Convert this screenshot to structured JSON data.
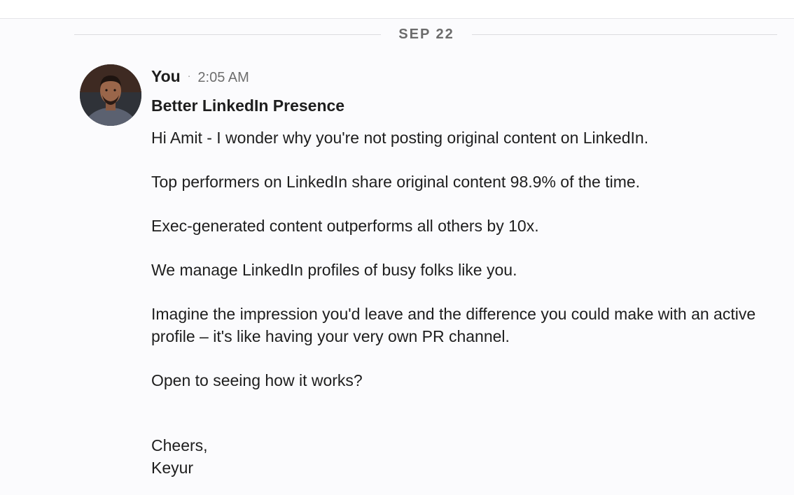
{
  "date_divider": {
    "label": "SEP 22"
  },
  "message": {
    "sender": "You",
    "separator": "·",
    "time": "2:05 AM",
    "subject": "Better LinkedIn Presence",
    "paragraphs": [
      "Hi Amit - I wonder why you're not posting original content on LinkedIn.",
      "Top performers on LinkedIn share original content 98.9% of the time.",
      "Exec-generated content outperforms all others by 10x.",
      "We manage LinkedIn profiles of busy folks like you.",
      "Imagine the impression you'd leave and the difference you could make with an active profile – it's like having your very own PR channel.",
      "Open to seeing how it works?"
    ],
    "signoff": "Cheers,",
    "signature": "Keyur"
  }
}
